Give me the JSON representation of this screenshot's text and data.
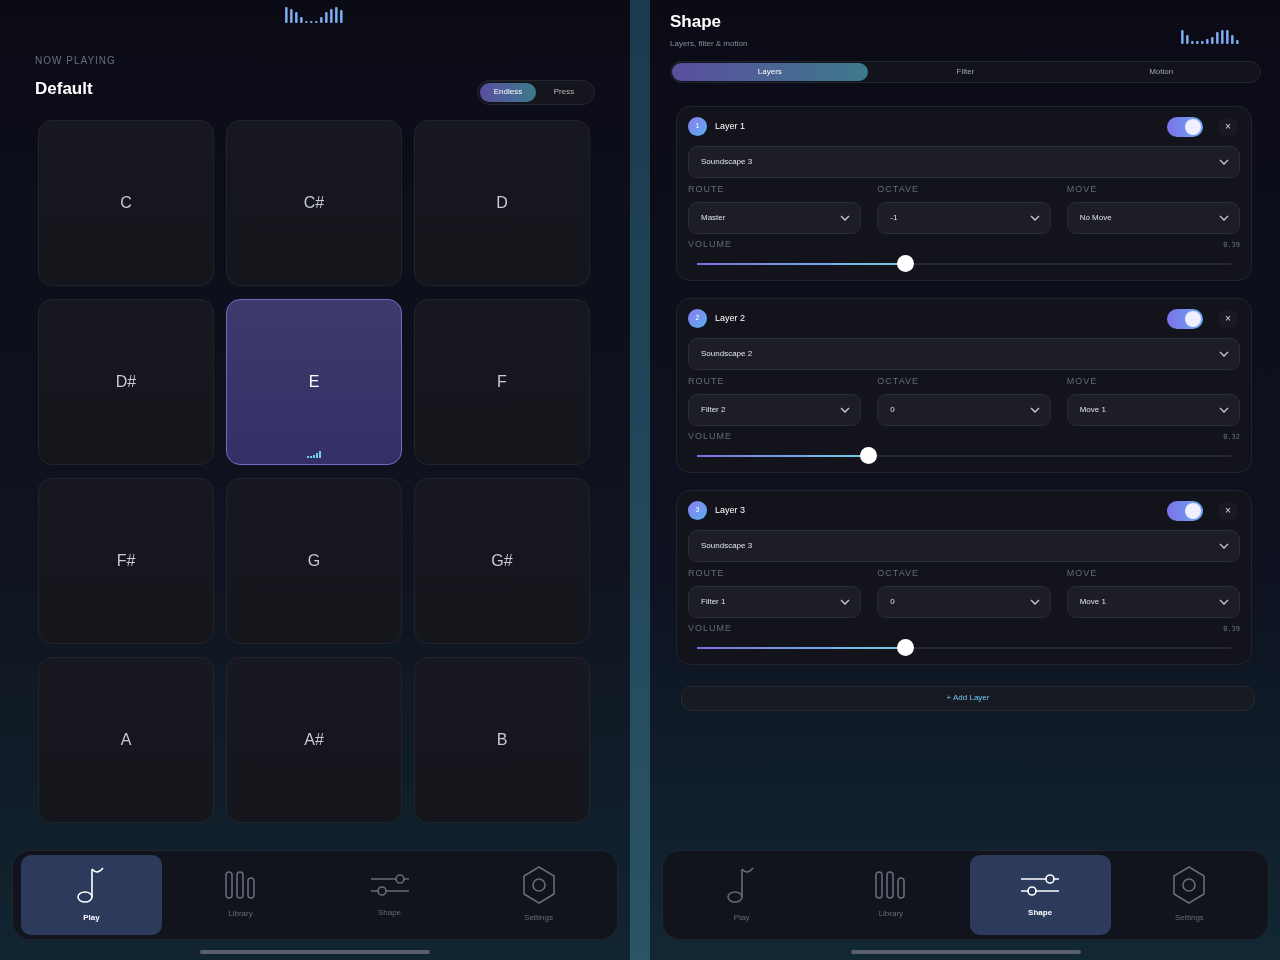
{
  "play_panel": {
    "eyebrow": "NOW PLAYING",
    "preset": "Default",
    "modes": [
      {
        "label": "Endless",
        "selected": true
      },
      {
        "label": "Press",
        "selected": false
      }
    ],
    "pads": [
      {
        "note": "C",
        "selected": false
      },
      {
        "note": "C#",
        "selected": false
      },
      {
        "note": "D",
        "selected": false
      },
      {
        "note": "D#",
        "selected": false
      },
      {
        "note": "E",
        "selected": true
      },
      {
        "note": "F",
        "selected": false
      },
      {
        "note": "F#",
        "selected": false
      },
      {
        "note": "G",
        "selected": false
      },
      {
        "note": "G#",
        "selected": false
      },
      {
        "note": "A",
        "selected": false
      },
      {
        "note": "A#",
        "selected": false
      },
      {
        "note": "B",
        "selected": false
      }
    ],
    "nav": [
      {
        "label": "Play",
        "selected": true
      },
      {
        "label": "Library",
        "selected": false
      },
      {
        "label": "Shape",
        "selected": false
      },
      {
        "label": "Settings",
        "selected": false
      }
    ]
  },
  "shape_panel": {
    "title": "Shape",
    "subtitle": "Layers, filter & motion",
    "tabs": [
      {
        "label": "Layers",
        "selected": true
      },
      {
        "label": "Filter",
        "selected": false
      },
      {
        "label": "Motion",
        "selected": false
      }
    ],
    "layers": [
      {
        "number": "1",
        "name": "Layer 1",
        "on": true,
        "close": "×",
        "sound": "Soundscape 3",
        "route_label": "ROUTE",
        "route": "Master",
        "octave_label": "OCTAVE",
        "octave": "-1",
        "move_label": "MOVE",
        "move": "No Move",
        "volume_label": "VOLUME",
        "volume_reading": "0.39",
        "level": 0.39
      },
      {
        "number": "2",
        "name": "Layer 2",
        "on": true,
        "close": "×",
        "sound": "Soundscape 2",
        "route_label": "ROUTE",
        "route": "Filter 2",
        "octave_label": "OCTAVE",
        "octave": "0",
        "move_label": "MOVE",
        "move": "Move 1",
        "volume_label": "VOLUME",
        "volume_reading": "0.32",
        "level": 0.32
      },
      {
        "number": "3",
        "name": "Layer 3",
        "on": true,
        "close": "×",
        "sound": "Soundscape 3",
        "route_label": "ROUTE",
        "route": "Filter 1",
        "octave_label": "OCTAVE",
        "octave": "0",
        "move_label": "MOVE",
        "move": "Move 1",
        "volume_label": "VOLUME",
        "volume_reading": "0.39",
        "level": 0.39
      }
    ],
    "add_layer": "+ Add Layer",
    "nav": [
      {
        "label": "Play",
        "selected": false
      },
      {
        "label": "Library",
        "selected": false
      },
      {
        "label": "Shape",
        "selected": true
      },
      {
        "label": "Settings",
        "selected": false
      }
    ]
  }
}
